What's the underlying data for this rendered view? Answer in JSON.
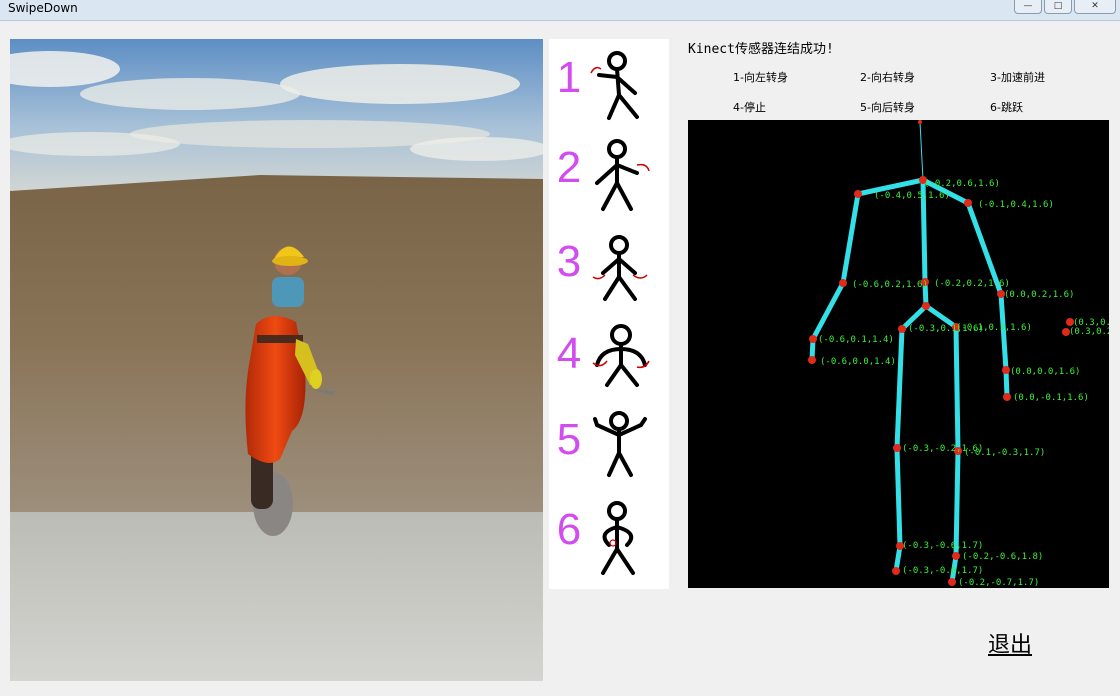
{
  "window": {
    "title": "SwipeDown"
  },
  "titlebar_buttons": {
    "minimize": "—",
    "maximize": "□",
    "close": "✕"
  },
  "gestures": [
    {
      "number": "1"
    },
    {
      "number": "2"
    },
    {
      "number": "3"
    },
    {
      "number": "4"
    },
    {
      "number": "5"
    },
    {
      "number": "6"
    }
  ],
  "status_text": "Kinect传感器连结成功!",
  "commands": [
    "1-向左转身",
    "2-向右转身",
    "3-加速前进",
    "4-停止",
    "5-向后转身",
    "6-跳跃"
  ],
  "skeleton_labels": [
    "(-0.2,0.6,1.6)",
    "(-0.4,0.5,1.6)",
    "(-0.1,0.4,1.6)",
    "(-0.6,0.2,1.6)",
    "(-0.2,0.2,1.6)",
    "(0.0,0.2,1.6)",
    "(-0.6,0.1,1.4)",
    "(-0.6,0.0,1.4)",
    "(-0.3,0.1,1.6)",
    "(-0.1,0.1,1.6)",
    "(0.0,0.0,1.6)",
    "(0.0,-0.1,1.6)",
    "(0.3,0.2",
    "(0.3,0.2,1",
    "(-0.3,-0.2,1.6)",
    "(-0.1,-0.3,1.7)",
    "(-0.3,-0.6,1.7)",
    "(-0.2,-0.6,1.8)",
    "(-0.3,-0.6,1.7)",
    "(-0.2,-0.7,1.7)"
  ],
  "exit_label": "退出",
  "colors": {
    "gesture_number": "#d24cf0",
    "bone": "#33e0e8",
    "joint": "#e02a1a",
    "joint_label": "#3cf03c"
  }
}
